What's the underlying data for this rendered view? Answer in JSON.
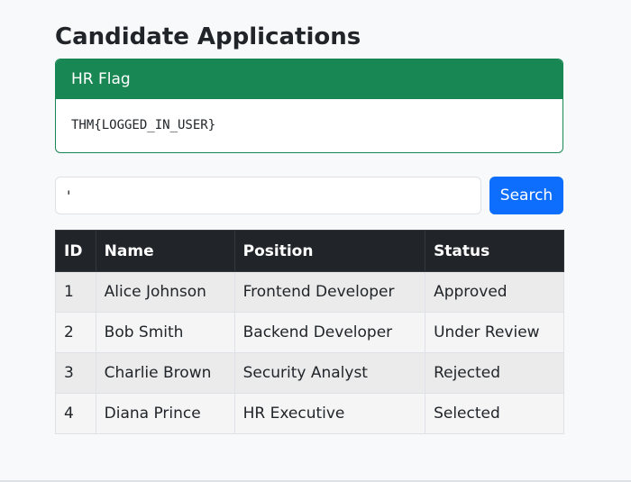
{
  "page": {
    "title": "Candidate Applications"
  },
  "flag_card": {
    "header": "HR Flag",
    "body": "THM{LOGGED_IN_USER}",
    "accent_color": "#198754"
  },
  "search": {
    "value": "'",
    "button_label": "Search",
    "button_color": "#0d6efd"
  },
  "table": {
    "headers": {
      "id": "ID",
      "name": "Name",
      "position": "Position",
      "status": "Status"
    },
    "rows": [
      {
        "id": "1",
        "name": "Alice Johnson",
        "position": "Frontend Developer",
        "status": "Approved"
      },
      {
        "id": "2",
        "name": "Bob Smith",
        "position": "Backend Developer",
        "status": "Under Review"
      },
      {
        "id": "3",
        "name": "Charlie Brown",
        "position": "Security Analyst",
        "status": "Rejected"
      },
      {
        "id": "4",
        "name": "Diana Prince",
        "position": "HR Executive",
        "status": "Selected"
      }
    ]
  }
}
